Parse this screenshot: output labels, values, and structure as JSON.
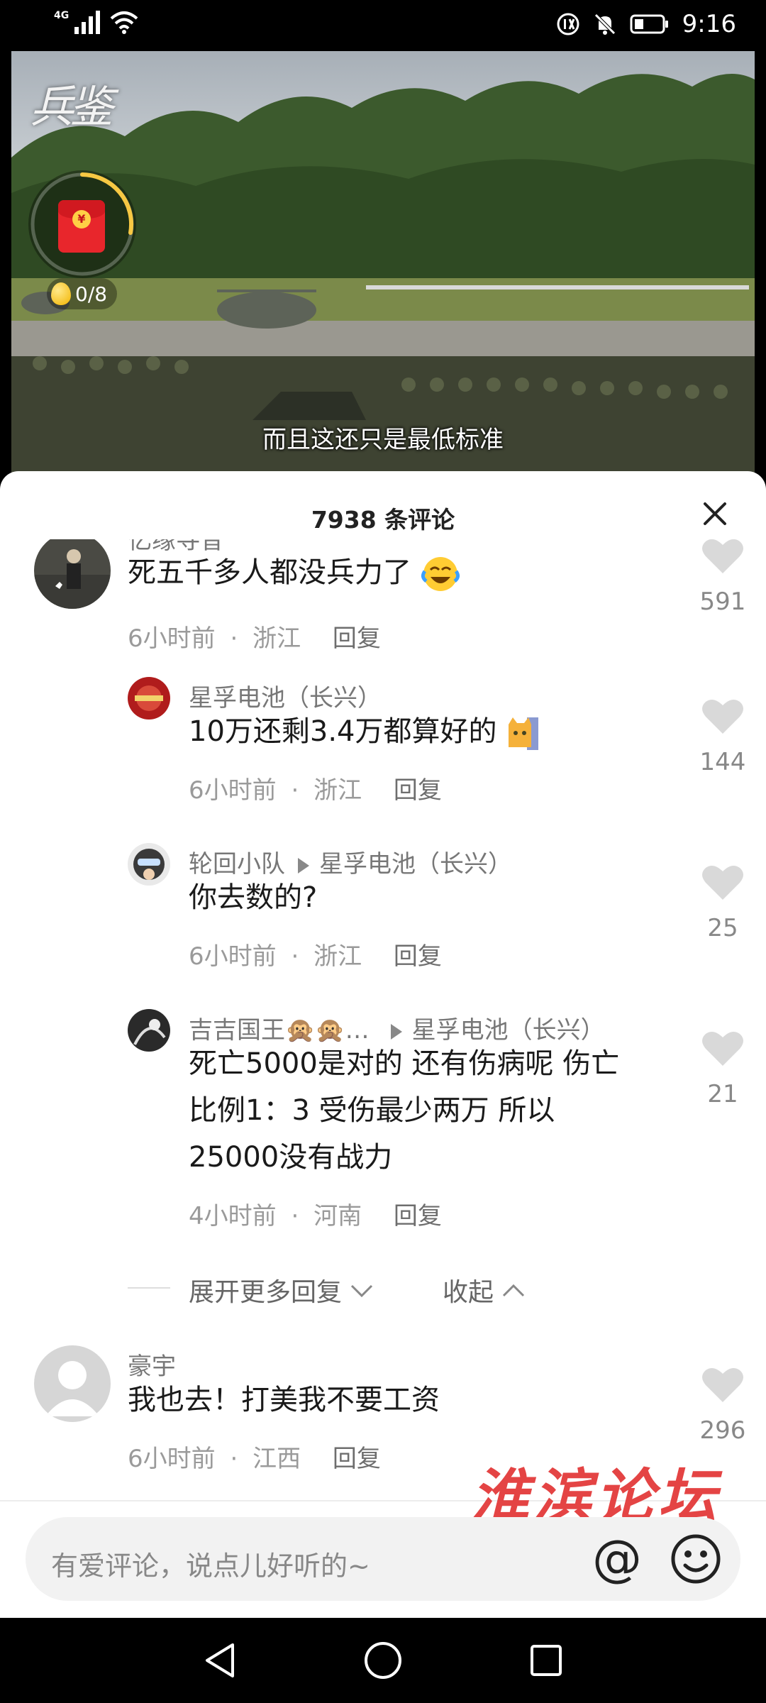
{
  "status_bar": {
    "network": "4G",
    "time": "9:16",
    "icons": [
      "signal-icon",
      "wifi-icon",
      "hd-icon",
      "mute-bell-icon",
      "battery-icon"
    ]
  },
  "video": {
    "logo_text": "兵鉴",
    "red_packet_progress": 0.35,
    "egg_counter": "0/8",
    "subtitle": "而且这还只是最低标准"
  },
  "comments_panel": {
    "title": "7938 条评论",
    "comments": [
      {
        "name": "忆缘寻昔",
        "text": "死五千多人都没兵力了",
        "time": "6小时前",
        "location": "浙江",
        "reply_label": "回复",
        "likes": "591"
      },
      {
        "name": "星孚电池（长兴）",
        "text": "10万还剩3.4万都算好的",
        "time": "6小时前",
        "location": "浙江",
        "reply_label": "回复",
        "likes": "144"
      },
      {
        "name": "轮回小队",
        "reply_to": "星孚电池（长兴）",
        "text": "你去数的?",
        "time": "6小时前",
        "location": "浙江",
        "reply_label": "回复",
        "likes": "25"
      },
      {
        "name": "吉吉国王🙊🙊…",
        "reply_to": "星孚电池（长兴）",
        "text_lines": [
          "死亡5000是对的 还有伤病呢 伤亡",
          "比例1：3 受伤最少两万 所以",
          "25000没有战力"
        ],
        "time": "4小时前",
        "location": "河南",
        "reply_label": "回复",
        "likes": "21"
      },
      {
        "name": "豪宇",
        "text": "我也去！打美我不要工资",
        "time": "6小时前",
        "location": "江西",
        "reply_label": "回复",
        "likes": "296"
      }
    ],
    "expand_more": "展开更多回复",
    "collapse": "收起",
    "meta_separator": "·"
  },
  "input": {
    "placeholder": "有爱评论，说点儿好听的~",
    "at_symbol": "@"
  },
  "watermark": "淮滨论坛",
  "colors": {
    "accent_red": "#e33a3a",
    "panel_bg": "#ffffff",
    "muted_text": "#9a9a9a"
  }
}
